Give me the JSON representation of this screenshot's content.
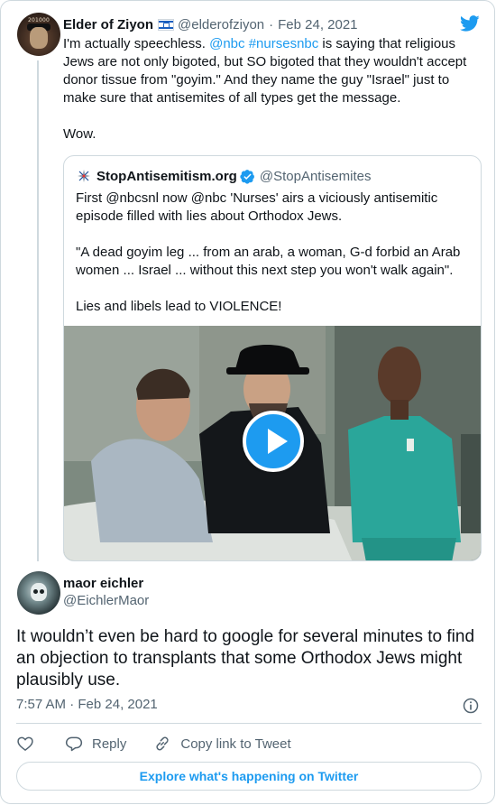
{
  "parent_tweet": {
    "avatar_text": "201000",
    "name": "Elder of Ziyon",
    "flag_icon": "israel-flag-icon",
    "handle": "@elderofziyon",
    "separator": "·",
    "date": "Feb 24, 2021",
    "text_part1": "I'm actually speechless. ",
    "mention": "@nbc",
    "space": " ",
    "hashtag": "#nursesnbc",
    "text_part2": " is saying that religious Jews are not only bigoted, but SO bigoted that they wouldn't accept donor tissue from \"goyim.\" And they name the guy \"Israel\" just to make sure that antisemites of all types get the message.\n\nWow."
  },
  "quoted_tweet": {
    "name": "StopAntisemitism.org",
    "handle": "@StopAntisemites",
    "text": "First @nbcsnl now @nbc 'Nurses' airs a viciously antisemitic episode filled with lies about Orthodox Jews.\n\n\"A dead goyim leg ... from an arab, a woman, G-d forbid an Arab women ... Israel ... without this next step you won't walk again\".\n\nLies and libels lead to VIOLENCE!"
  },
  "main_tweet": {
    "name": "maor eichler",
    "handle": "@EichlerMaor",
    "text": "It wouldn’t even be hard to google for several minutes to find an objection to transplants that some Orthodox Jews might plausibly use.",
    "time": "7:57 AM · Feb 24, 2021"
  },
  "actions": {
    "reply_label": "Reply",
    "copy_link_label": "Copy link to Tweet"
  },
  "explore_label": "Explore what's happening on Twitter",
  "icons": {
    "brand": "twitter-bird-icon",
    "verified": "verified-badge-icon",
    "play": "play-icon",
    "info": "info-icon",
    "like": "heart-icon",
    "reply": "reply-icon",
    "copy": "link-icon"
  },
  "colors": {
    "accent": "#1d9bf0",
    "text": "#0f1419",
    "secondary": "#536471",
    "border": "#cfd9de"
  }
}
